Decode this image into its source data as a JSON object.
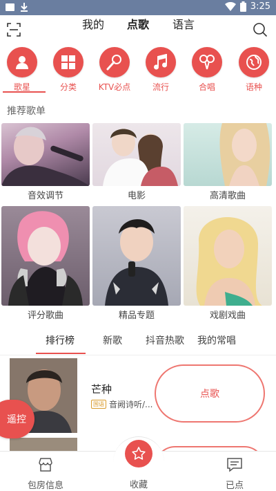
{
  "statusbar": {
    "time": "3:25"
  },
  "topnav": {
    "tabs": [
      {
        "label": "我的"
      },
      {
        "label": "点歌"
      },
      {
        "label": "语言"
      }
    ]
  },
  "categories": [
    {
      "label": "歌星",
      "icon": "singer-icon"
    },
    {
      "label": "分类",
      "icon": "grid-icon"
    },
    {
      "label": "KTV必点",
      "icon": "microphone-icon"
    },
    {
      "label": "流行",
      "icon": "music-note-icon"
    },
    {
      "label": "合唱",
      "icon": "duet-icon"
    },
    {
      "label": "语种",
      "icon": "globe-icon"
    }
  ],
  "section_title": "推荐歌单",
  "playlists": [
    {
      "label": "音效调节"
    },
    {
      "label": "电影"
    },
    {
      "label": "高清歌曲"
    },
    {
      "label": "评分歌曲"
    },
    {
      "label": "精品专题"
    },
    {
      "label": "戏剧戏曲"
    }
  ],
  "subtabs": [
    {
      "label": "排行榜"
    },
    {
      "label": "新歌"
    },
    {
      "label": "抖音热歌"
    },
    {
      "label": "我的常唱"
    }
  ],
  "song": {
    "title": "芒种",
    "badge": "国语",
    "subtitle": "音阙诗听/...",
    "order_label": "点歌"
  },
  "remote_label": "遥控",
  "bottombar": {
    "left_label": "包房信息",
    "center_label": "收藏",
    "right_label": "已点"
  },
  "colors": {
    "accent": "#e8514f",
    "statusbar": "#6a7ea0"
  }
}
